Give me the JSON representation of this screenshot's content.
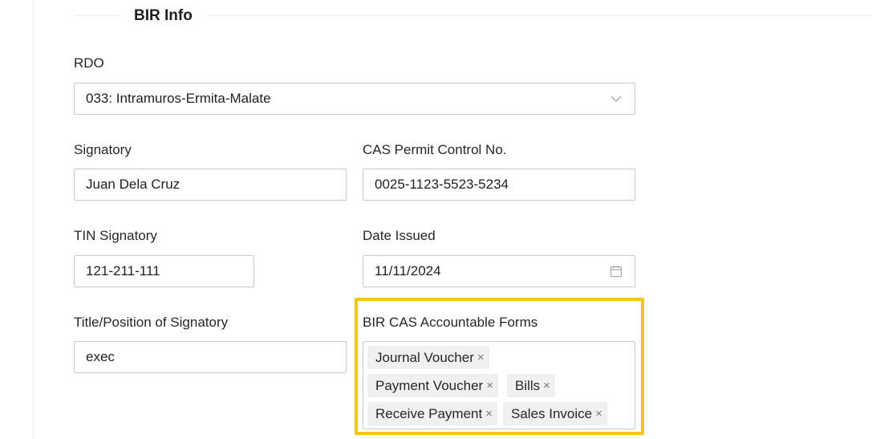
{
  "section": {
    "title": "BIR Info"
  },
  "fields": {
    "rdo": {
      "label": "RDO",
      "value": "033: Intramuros-Ermita-Malate",
      "icon": "chevron-down-icon"
    },
    "signatory": {
      "label": "Signatory",
      "value": "Juan Dela Cruz"
    },
    "cas_permit": {
      "label": "CAS Permit Control No.",
      "value": "0025-1123-5523-5234"
    },
    "tin_signatory": {
      "label": "TIN Signatory",
      "value": "121-211-111"
    },
    "date_issued": {
      "label": "Date Issued",
      "value": "11/11/2024",
      "icon": "calendar-icon"
    },
    "title_position": {
      "label": "Title/Position of Signatory",
      "value": "exec"
    },
    "accountable_forms": {
      "label": "BIR CAS Accountable Forms",
      "tags": [
        {
          "label": "Journal Voucher"
        },
        {
          "label": "Payment Voucher"
        },
        {
          "label": "Bills"
        },
        {
          "label": "Receive Payment"
        },
        {
          "label": "Sales Invoice"
        }
      ],
      "remove_glyph": "×"
    }
  },
  "colors": {
    "highlight": "#f5c518",
    "border": "#c9c9c9",
    "tag_bg": "#f0f0f0"
  }
}
